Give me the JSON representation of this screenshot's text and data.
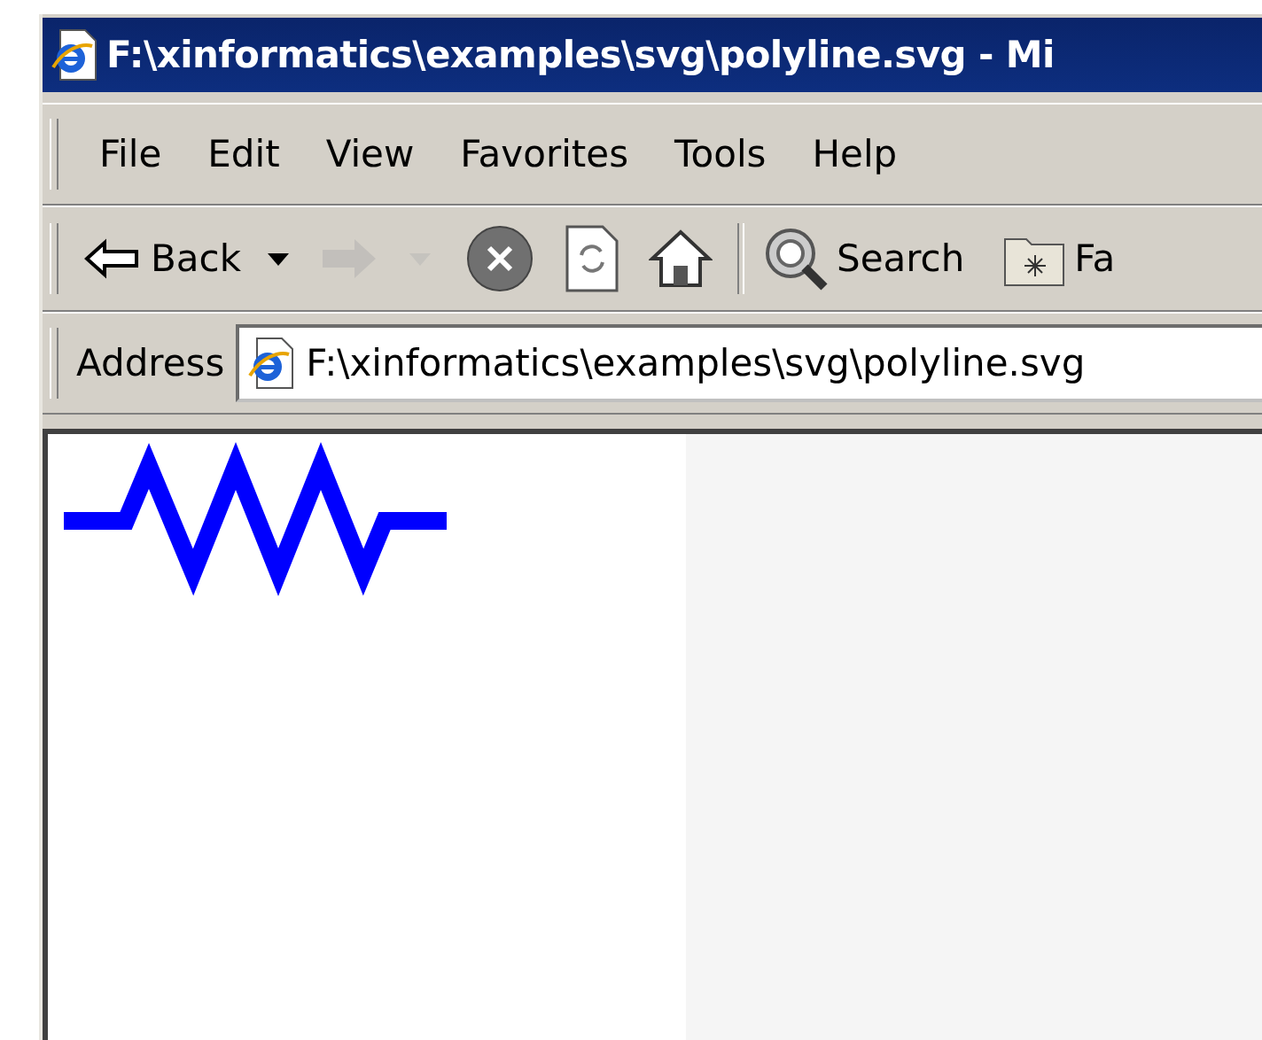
{
  "window": {
    "title": "F:\\xinformatics\\examples\\svg\\polyline.svg - Mi"
  },
  "menu_bar": {
    "items": [
      "File",
      "Edit",
      "View",
      "Favorites",
      "Tools",
      "Help"
    ]
  },
  "toolbar": {
    "items": [
      {
        "kind": "back",
        "label": "Back",
        "disabled": false
      },
      {
        "kind": "dropdown",
        "disabled": false
      },
      {
        "kind": "forward",
        "disabled": true
      },
      {
        "kind": "dropdown",
        "disabled": true
      },
      {
        "kind": "stop",
        "disabled": false
      },
      {
        "kind": "refresh",
        "disabled": false
      },
      {
        "kind": "home",
        "disabled": false
      },
      {
        "kind": "separator"
      },
      {
        "kind": "search",
        "label": "Search",
        "disabled": false
      },
      {
        "kind": "favorites",
        "label": "Fa",
        "disabled": false
      }
    ]
  },
  "address_bar": {
    "label": "Address",
    "value": "F:\\xinformatics\\examples\\svg\\polyline.svg"
  },
  "content": {
    "kind": "polyline"
  }
}
